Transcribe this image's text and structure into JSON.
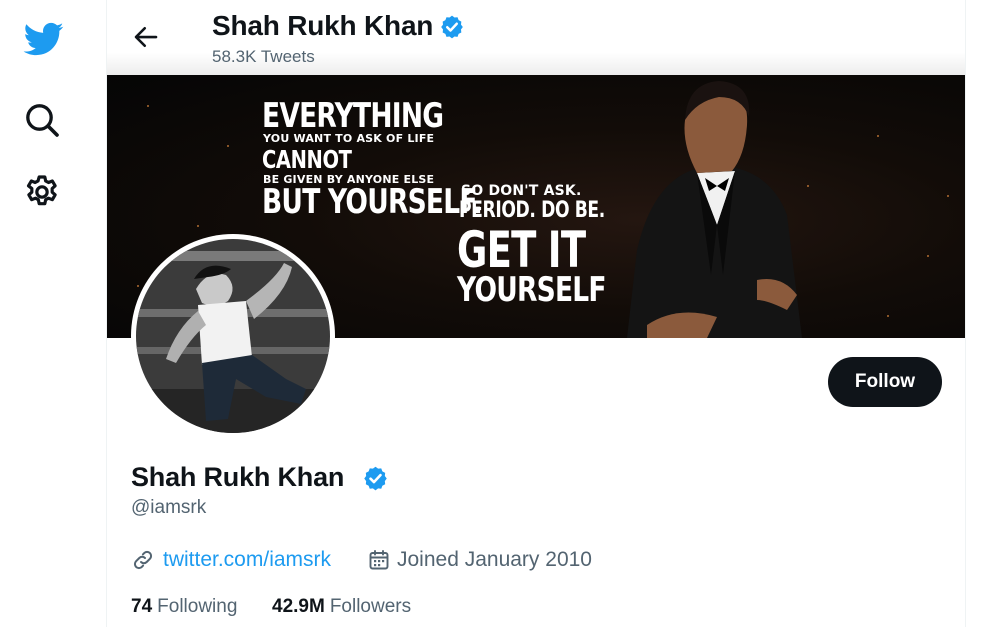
{
  "nav": {
    "logo_icon": "twitter-bird-icon",
    "search_icon": "search-icon",
    "settings_icon": "gear-icon",
    "brand_color": "#1d9bf0"
  },
  "header": {
    "name": "Shah Rukh Khan",
    "tweet_count": "58.3K Tweets",
    "back_icon": "arrow-left-icon",
    "verified_icon": "verified-badge-icon"
  },
  "banner": {
    "quote_lines": [
      "EVERYTHING",
      "YOU WANT TO ASK OF LIFE",
      "CANNOT",
      "BE GIVEN BY ANYONE ELSE",
      "BUT YOURSELF.",
      "SO DON'T ASK.",
      "PERIOD. DO BE.",
      "GET IT",
      "YOURSELF"
    ]
  },
  "profile": {
    "name": "Shah Rukh Khan",
    "handle": "@iamsrk",
    "website": "twitter.com/iamsrk",
    "joined": "Joined January 2010",
    "following_count": "74",
    "following_label": "Following",
    "followers_count": "42.9M",
    "followers_label": "Followers",
    "follow_button": "Follow"
  }
}
